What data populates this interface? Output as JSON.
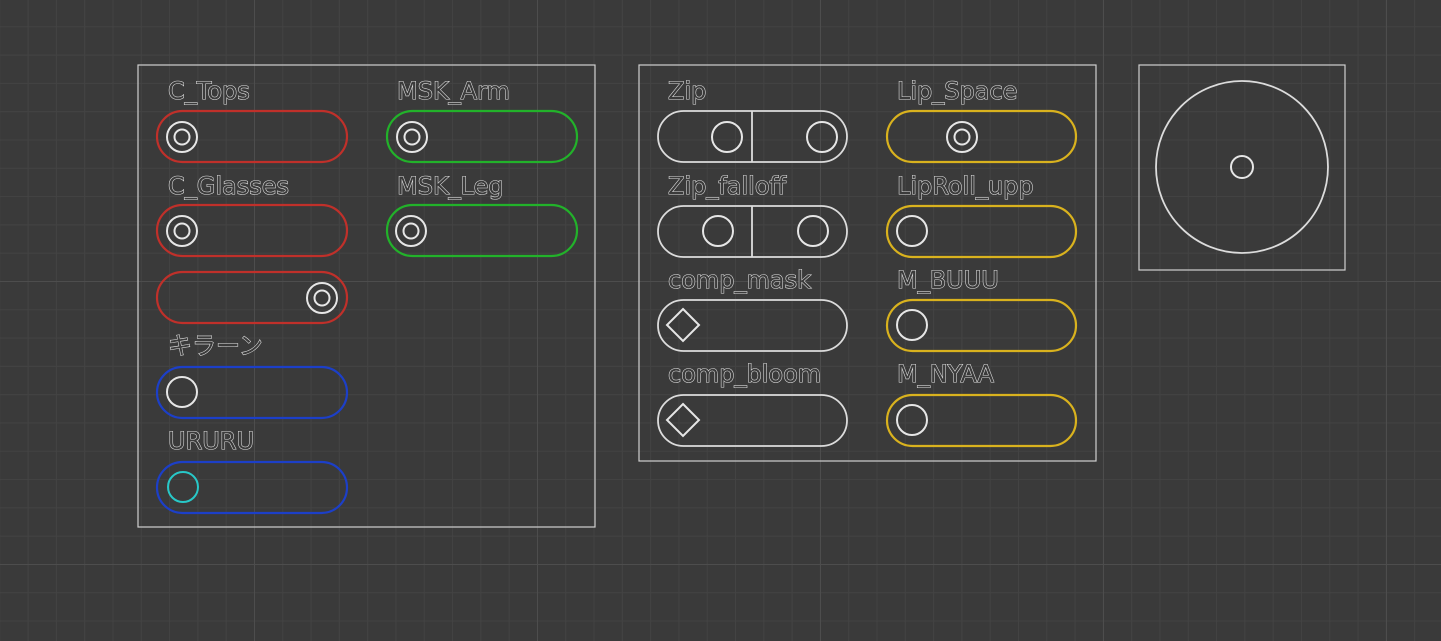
{
  "colors": {
    "red": "#c0302a",
    "green": "#22b22a",
    "blue": "#1c3fc8",
    "yellow": "#d9b21e",
    "cyan": "#28c8c8",
    "white": "#dcdcdc"
  },
  "panel_left": {
    "c_tops_label": "C_Tops",
    "msk_arm_label": "MSK_Arm",
    "c_glasses_label": "C_Glasses",
    "msk_leg_label": "MSK_Leg",
    "kiraan_label": "キラーン",
    "ururu_label": "URURU"
  },
  "panel_middle": {
    "zip_label": "Zip",
    "lip_space_label": "Lip_Space",
    "zip_falloff_label": "Zip_falloff",
    "liproll_upp_label": "LipRoll_upp",
    "comp_mask_label": "comp_mask",
    "m_buuu_label": "M_BUUU",
    "comp_bloom_label": "comp_bloom",
    "m_nyaa_label": "M_NYAA"
  },
  "slider_values": {
    "c_tops": 0.0,
    "msk_arm": 0.0,
    "c_glasses": 0.0,
    "c_glasses_secondary": 1.0,
    "kiraan": 0.0,
    "ururu": 0.0,
    "lip_space": 0.4,
    "liproll_upp": 0.0,
    "m_buuu": 0.0,
    "m_nyaa": 0.0,
    "comp_mask": 0.0,
    "comp_bloom": 0.0
  }
}
